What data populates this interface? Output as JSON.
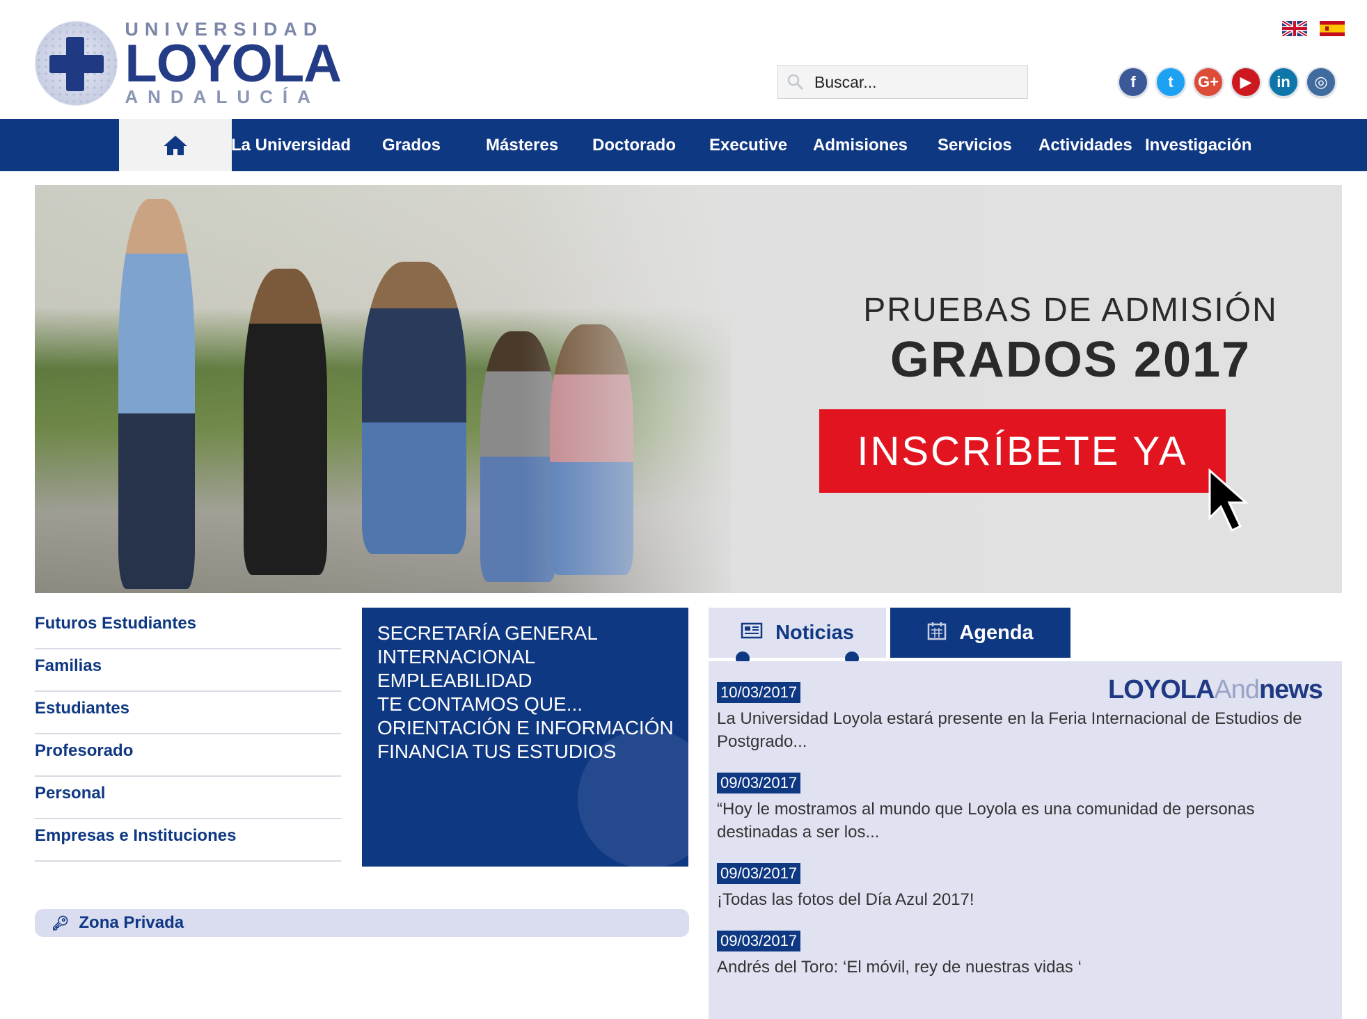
{
  "logo": {
    "top": "UNIVERSIDAD",
    "main": "LOYOLA",
    "bottom": "ANDALUCÍA"
  },
  "search": {
    "placeholder": "Buscar..."
  },
  "languages": [
    "english-flag",
    "spanish-flag"
  ],
  "social": [
    {
      "name": "facebook-icon",
      "glyph": "f",
      "color": "#3b5998"
    },
    {
      "name": "twitter-icon",
      "glyph": "t",
      "color": "#1da1f2"
    },
    {
      "name": "google-plus-icon",
      "glyph": "G+",
      "color": "#dd4b39"
    },
    {
      "name": "youtube-icon",
      "glyph": "▶",
      "color": "#cc181e"
    },
    {
      "name": "linkedin-icon",
      "glyph": "in",
      "color": "#0e76a8"
    },
    {
      "name": "instagram-icon",
      "glyph": "◎",
      "color": "#3f6b9e"
    }
  ],
  "nav": {
    "home_icon": "home-icon",
    "items": [
      "La Universidad",
      "Grados",
      "Másteres",
      "Doctorado",
      "Executive",
      "Admisiones",
      "Servicios",
      "Actividades",
      "Investigación"
    ]
  },
  "banner": {
    "line1": "PRUEBAS DE ADMISIÓN",
    "line2": "GRADOS 2017",
    "cta": "INSCRÍBETE YA"
  },
  "sidebar": {
    "links": [
      "Futuros Estudiantes",
      "Familias",
      "Estudiantes",
      "Profesorado",
      "Personal",
      "Empresas e Instituciones"
    ],
    "private": "Zona Privada"
  },
  "bluebox": {
    "links": [
      "SECRETARÍA GENERAL",
      "INTERNACIONAL",
      "EMPLEABILIDAD",
      "TE CONTAMOS QUE...",
      "ORIENTACIÓN E INFORMACIÓN",
      "FINANCIA TUS ESTUDIOS"
    ]
  },
  "tabs": {
    "news": "Noticias",
    "agenda": "Agenda"
  },
  "news_brand": {
    "part1": "LOYOLA",
    "part2": "And",
    "part3": "news"
  },
  "news": [
    {
      "date": "10/03/2017",
      "text": "La Universidad Loyola estará presente en la Feria Internacional de Estudios de Postgrado..."
    },
    {
      "date": "09/03/2017",
      "text": "“Hoy le mostramos al mundo que Loyola es una comunidad de personas destinadas a ser los..."
    },
    {
      "date": "09/03/2017",
      "text": "¡Todas las fotos del Día Azul 2017!"
    },
    {
      "date": "09/03/2017",
      "text": "Andrés del Toro: ‘El móvil, rey de nuestras vidas ‘"
    }
  ],
  "colors": {
    "primary": "#0f3883",
    "cta": "#e2141f",
    "news_bg": "#e0e2f2"
  }
}
